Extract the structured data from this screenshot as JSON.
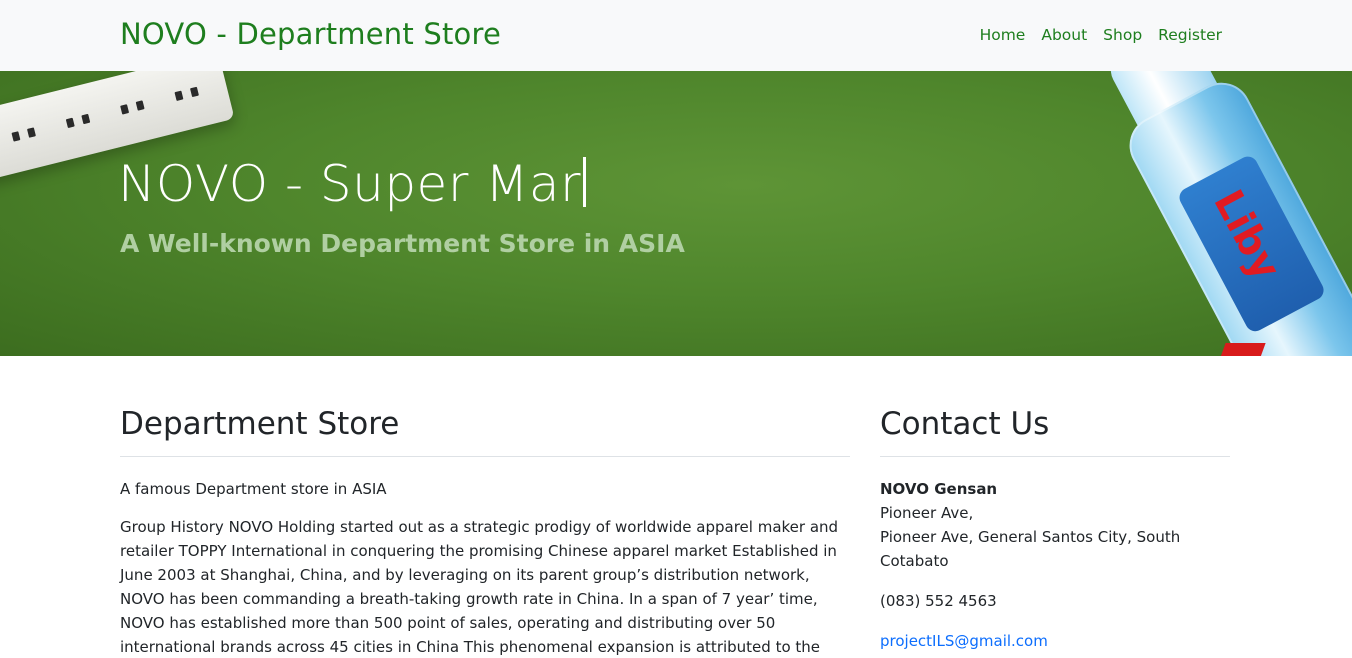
{
  "navbar": {
    "brand": "NOVO - Department Store",
    "links": [
      "Home",
      "About",
      "Shop",
      "Register"
    ]
  },
  "hero": {
    "title": "NOVO - Super Mar",
    "subtitle": "A Well-known Department Store in ASIA",
    "bottle_logo": "Liby"
  },
  "main": {
    "heading": "Department Store",
    "intro": "A famous Department store in ASIA",
    "history": "Group History NOVO Holding started out as a strategic prodigy of worldwide apparel maker and retailer TOPPY International in conquering the promising Chinese apparel market Established in June 2003 at Shanghai, China, and by leveraging on its parent group’s distribution network, NOVO has been commanding a breath-taking growth rate in China. In a span of 7 year’ time, NOVO has established more than 500 point of sales, operating and distributing over 50 international brands across 45 cities in China This phenomenal expansion is attributed to the group’s strategic brand portfolio development"
  },
  "contact": {
    "heading": "Contact Us",
    "name": "NOVO Gensan",
    "address_line1": "Pioneer Ave,",
    "address_line2": "Pioneer Ave, General Santos City, South Cotabato",
    "phone": "(083) 552 4563",
    "email": "projectILS@gmail.com"
  },
  "colors": {
    "brand_green": "#1e7e1e",
    "hero_green": "#4f862c",
    "link_blue": "#0d6efd"
  }
}
